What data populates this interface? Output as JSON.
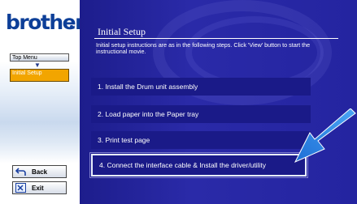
{
  "brand": {
    "logo_text": "brother"
  },
  "sidebar": {
    "menu": [
      {
        "label": "Top Menu"
      },
      {
        "label": "Initial Setup"
      }
    ],
    "back_label": "Back",
    "exit_label": "Exit"
  },
  "main": {
    "title": "Initial Setup",
    "intro": "Initial setup instructions are as in the following steps. Click 'View' button to start the instructional movie.",
    "steps": [
      {
        "label": "1. Install the Drum unit assembly"
      },
      {
        "label": "2. Load paper into the Paper tray"
      },
      {
        "label": "3. Print test page"
      },
      {
        "label": "4. Connect the interface cable & Install the driver/utility"
      }
    ]
  },
  "colors": {
    "brand_blue": "#0d3f98",
    "panel_blue": "#2424a0",
    "step_blue": "#1a1a88",
    "selected_menu": "#f2a500",
    "pointer_arrow": "#2a8ae8"
  }
}
